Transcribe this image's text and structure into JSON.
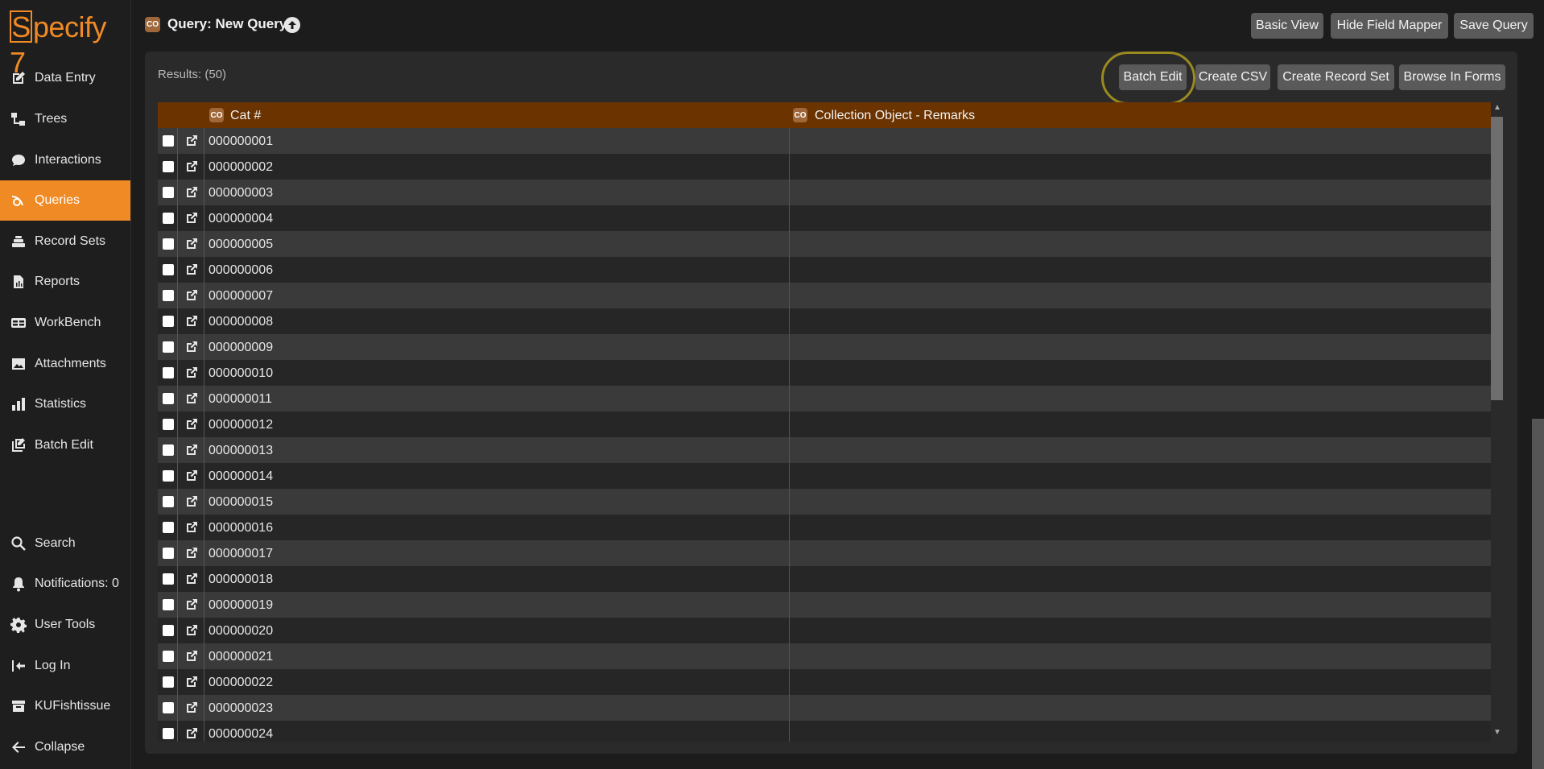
{
  "app": {
    "logo_s": "S",
    "logo_rest": "pecify 7"
  },
  "sidebar": {
    "items": [
      {
        "label": "Data Entry",
        "icon": "data-entry-icon",
        "active": false
      },
      {
        "label": "Trees",
        "icon": "trees-icon",
        "active": false
      },
      {
        "label": "Interactions",
        "icon": "interactions-icon",
        "active": false
      },
      {
        "label": "Queries",
        "icon": "queries-icon",
        "active": true
      },
      {
        "label": "Record Sets",
        "icon": "record-sets-icon",
        "active": false
      },
      {
        "label": "Reports",
        "icon": "reports-icon",
        "active": false
      },
      {
        "label": "WorkBench",
        "icon": "workbench-icon",
        "active": false
      },
      {
        "label": "Attachments",
        "icon": "attachments-icon",
        "active": false
      },
      {
        "label": "Statistics",
        "icon": "statistics-icon",
        "active": false
      },
      {
        "label": "Batch Edit",
        "icon": "batch-edit-icon",
        "active": false
      }
    ],
    "bottom_items": [
      {
        "label": "Search",
        "icon": "search-icon"
      },
      {
        "label": "Notifications: 0",
        "icon": "bell-icon"
      },
      {
        "label": "User Tools",
        "icon": "gear-icon"
      },
      {
        "label": "Log In",
        "icon": "log-in-icon"
      },
      {
        "label": "KUFishtissue",
        "icon": "collection-icon"
      },
      {
        "label": "Collapse",
        "icon": "arrow-left-icon"
      }
    ]
  },
  "header": {
    "badge": "CO",
    "title": "Query: New Query",
    "buttons": {
      "basic_view": "Basic View",
      "hide_field_mapper": "Hide Field Mapper",
      "save_query": "Save Query"
    }
  },
  "results": {
    "label": "Results: (50)",
    "buttons": {
      "batch_edit": "Batch Edit",
      "create_csv": "Create CSV",
      "create_record_set": "Create Record Set",
      "browse_in_forms": "Browse In Forms"
    }
  },
  "table": {
    "columns": [
      {
        "badge": "CO",
        "label": "Cat #"
      },
      {
        "badge": "CO",
        "label": "Collection Object - Remarks"
      }
    ],
    "rows": [
      {
        "cat": "000000001",
        "remarks": ""
      },
      {
        "cat": "000000002",
        "remarks": ""
      },
      {
        "cat": "000000003",
        "remarks": ""
      },
      {
        "cat": "000000004",
        "remarks": ""
      },
      {
        "cat": "000000005",
        "remarks": ""
      },
      {
        "cat": "000000006",
        "remarks": ""
      },
      {
        "cat": "000000007",
        "remarks": ""
      },
      {
        "cat": "000000008",
        "remarks": ""
      },
      {
        "cat": "000000009",
        "remarks": ""
      },
      {
        "cat": "000000010",
        "remarks": ""
      },
      {
        "cat": "000000011",
        "remarks": ""
      },
      {
        "cat": "000000012",
        "remarks": ""
      },
      {
        "cat": "000000013",
        "remarks": ""
      },
      {
        "cat": "000000014",
        "remarks": ""
      },
      {
        "cat": "000000015",
        "remarks": ""
      },
      {
        "cat": "000000016",
        "remarks": ""
      },
      {
        "cat": "000000017",
        "remarks": ""
      },
      {
        "cat": "000000018",
        "remarks": ""
      },
      {
        "cat": "000000019",
        "remarks": ""
      },
      {
        "cat": "000000020",
        "remarks": ""
      },
      {
        "cat": "000000021",
        "remarks": ""
      },
      {
        "cat": "000000022",
        "remarks": ""
      },
      {
        "cat": "000000023",
        "remarks": ""
      },
      {
        "cat": "000000024",
        "remarks": ""
      }
    ]
  },
  "colors": {
    "accent": "#f08a24",
    "header_row": "#6b3300",
    "annotation": "#9a8a20"
  }
}
